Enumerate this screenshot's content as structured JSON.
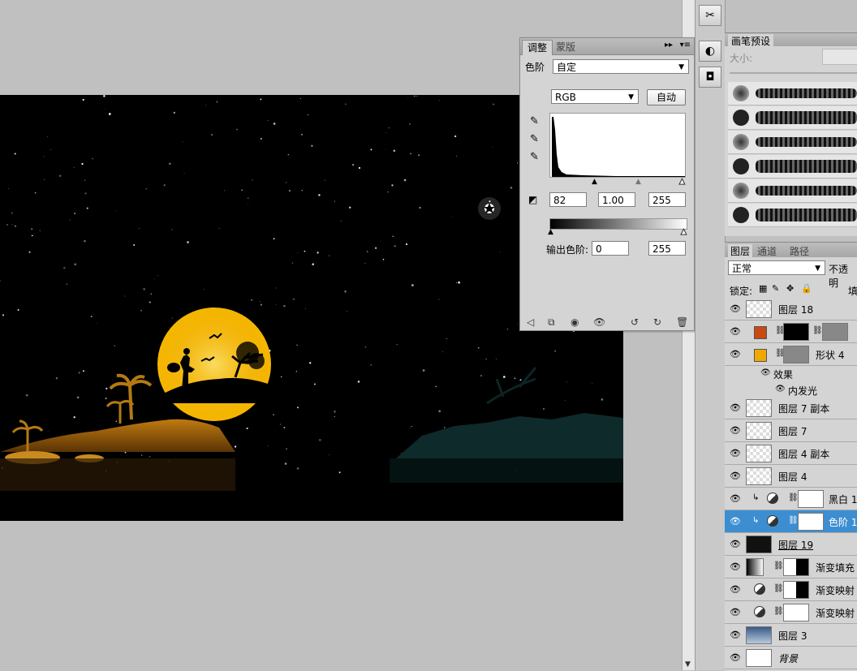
{
  "adjust_panel": {
    "tab_adjust": "调整",
    "tab_mask": "蒙版",
    "preset_label": "色阶",
    "preset_value": "自定",
    "channel_value": "RGB",
    "auto_button": "自动",
    "input_black": "82",
    "input_gamma": "1.00",
    "input_white": "255",
    "output_label": "输出色阶:",
    "output_black": "0",
    "output_white": "255"
  },
  "brush_panel": {
    "title": "画笔预设",
    "size_label": "大小:"
  },
  "layers_panel": {
    "tab_layers": "图层",
    "tab_channels": "通道",
    "tab_paths": "路径",
    "blend_mode": "正常",
    "opacity_label": "不透明",
    "lock_label": "锁定:",
    "fill_label": "填",
    "effects_label": "效果",
    "inner_glow_label": "内发光",
    "layers": [
      {
        "name": "图层 18"
      },
      {
        "name": ""
      },
      {
        "name": "形状 4"
      },
      {
        "name": "图层 7 副本"
      },
      {
        "name": "图层 7"
      },
      {
        "name": "图层 4 副本"
      },
      {
        "name": "图层 4"
      },
      {
        "name": "黑白 1"
      },
      {
        "name": "色阶 1"
      },
      {
        "name": "图层 19"
      },
      {
        "name": "渐变填充"
      },
      {
        "name": "渐变映射"
      },
      {
        "name": "渐变映射"
      },
      {
        "name": "图层 3"
      },
      {
        "name": "背景"
      }
    ]
  },
  "colors": {
    "selection": "#3d8ed1",
    "moon": "#f5b600",
    "shape_swatch_orange": "#f0a800",
    "shape_swatch_red": "#c84a10"
  },
  "icons": [
    "eye-icon",
    "eyedropper-icon",
    "chain-icon",
    "lock-icon",
    "move-icon",
    "brush-icon",
    "trash-icon",
    "reset-icon"
  ]
}
